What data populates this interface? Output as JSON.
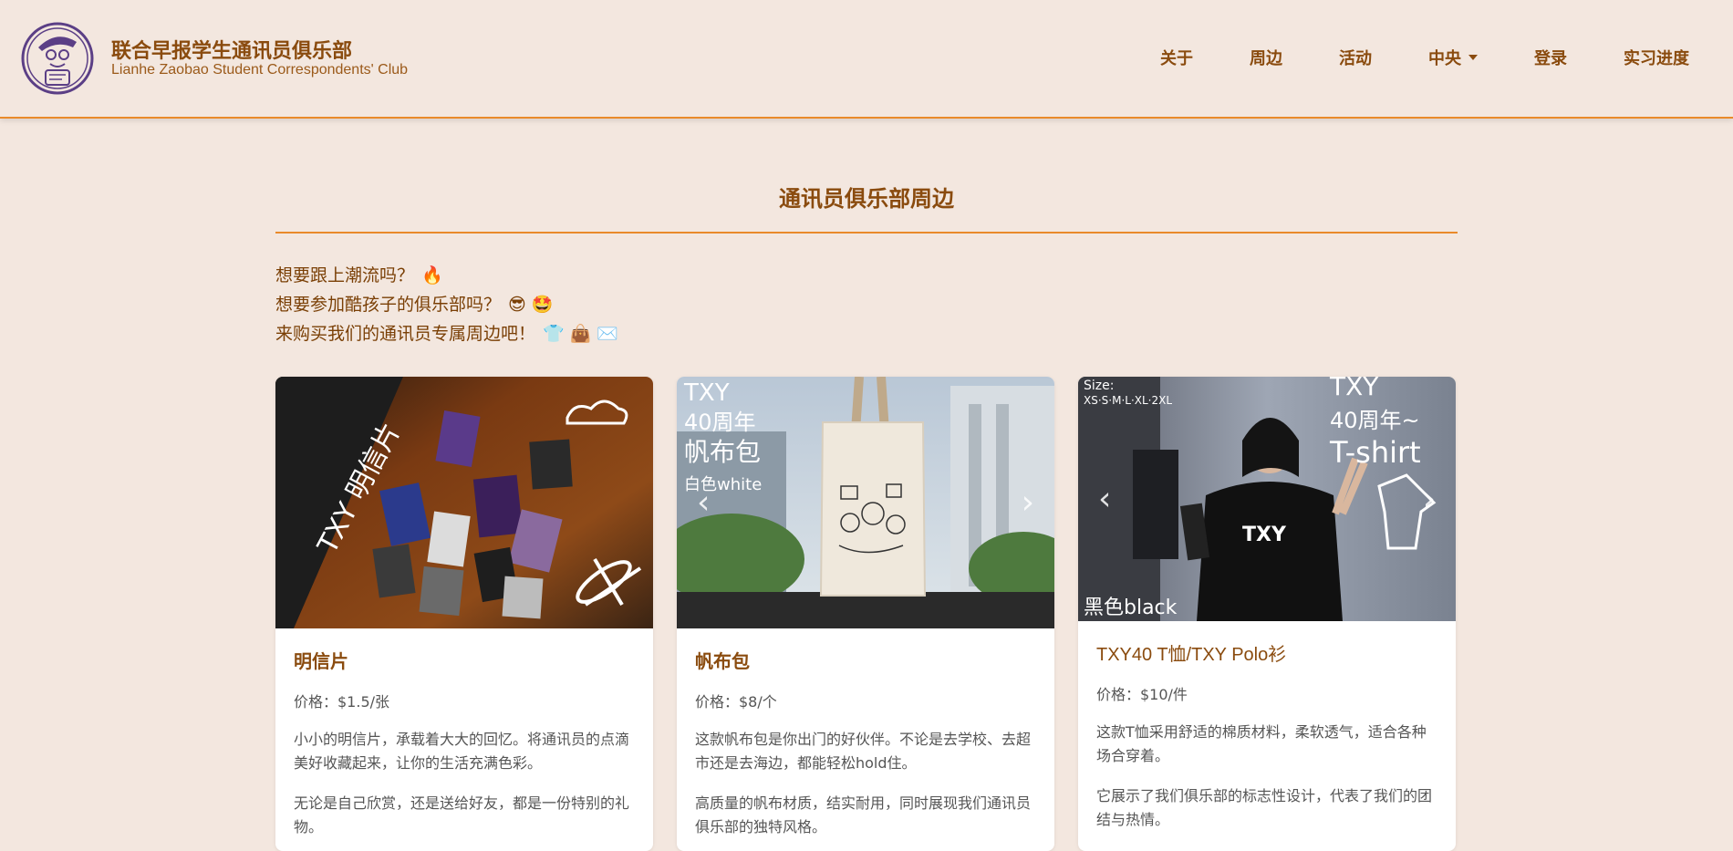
{
  "header": {
    "brand_cn": "联合早报学生通讯员俱乐部",
    "brand_en": "Lianhe Zaobao Student Correspondents' Club",
    "nav": [
      {
        "label": "关于"
      },
      {
        "label": "周边"
      },
      {
        "label": "活动"
      },
      {
        "label": "中央",
        "dropdown": true
      },
      {
        "label": "登录"
      },
      {
        "label": "实习进度"
      }
    ]
  },
  "main": {
    "title": "通讯员俱乐部周边",
    "intro": [
      {
        "text": "想要跟上潮流吗？",
        "emoji": "🔥"
      },
      {
        "text": "想要参加酷孩子的俱乐部吗？",
        "emoji": "😎 🤩"
      },
      {
        "text": "来购买我们的通讯员专属周边吧！",
        "emoji": "👕 👜 ✉️"
      }
    ],
    "cards": [
      {
        "title": "明信片",
        "price": "价格：$1.5/张",
        "text1": "小小的明信片，承载着大大的回忆。将通讯员的点滴美好收藏起来，让你的生活充满色彩。",
        "text2": "无论是自己欣赏，还是送给好友，都是一份特别的礼物。",
        "image_text": "TXY 明信片"
      },
      {
        "title": "帆布包",
        "price": "价格：$8/个",
        "text1": "这款帆布包是你出门的好伙伴。不论是去学校、去超市还是去海边，都能轻松hold住。",
        "text2": "高质量的帆布材质，结实耐用，同时展现我们通讯员俱乐部的独特风格。",
        "image_text": [
          "TXY",
          "40周年",
          "帆布包",
          "白色white"
        ]
      },
      {
        "title": "TXY40 T恤/TXY Polo衫",
        "price": "价格：$10/件",
        "text1": "这款T恤采用舒适的棉质材料，柔软透气，适合各种场合穿着。",
        "text2": "它展示了我们俱乐部的标志性设计，代表了我们的团结与热情。",
        "image_text": [
          "Size:",
          "XS·S·M·L·XL·2XL",
          "TXY",
          "40周年~",
          "T-shirt",
          "黑色black"
        ]
      }
    ]
  },
  "colors": {
    "background": "#f3e7df",
    "accent": "#e98a2a",
    "text_brown": "#8a4b0e"
  }
}
